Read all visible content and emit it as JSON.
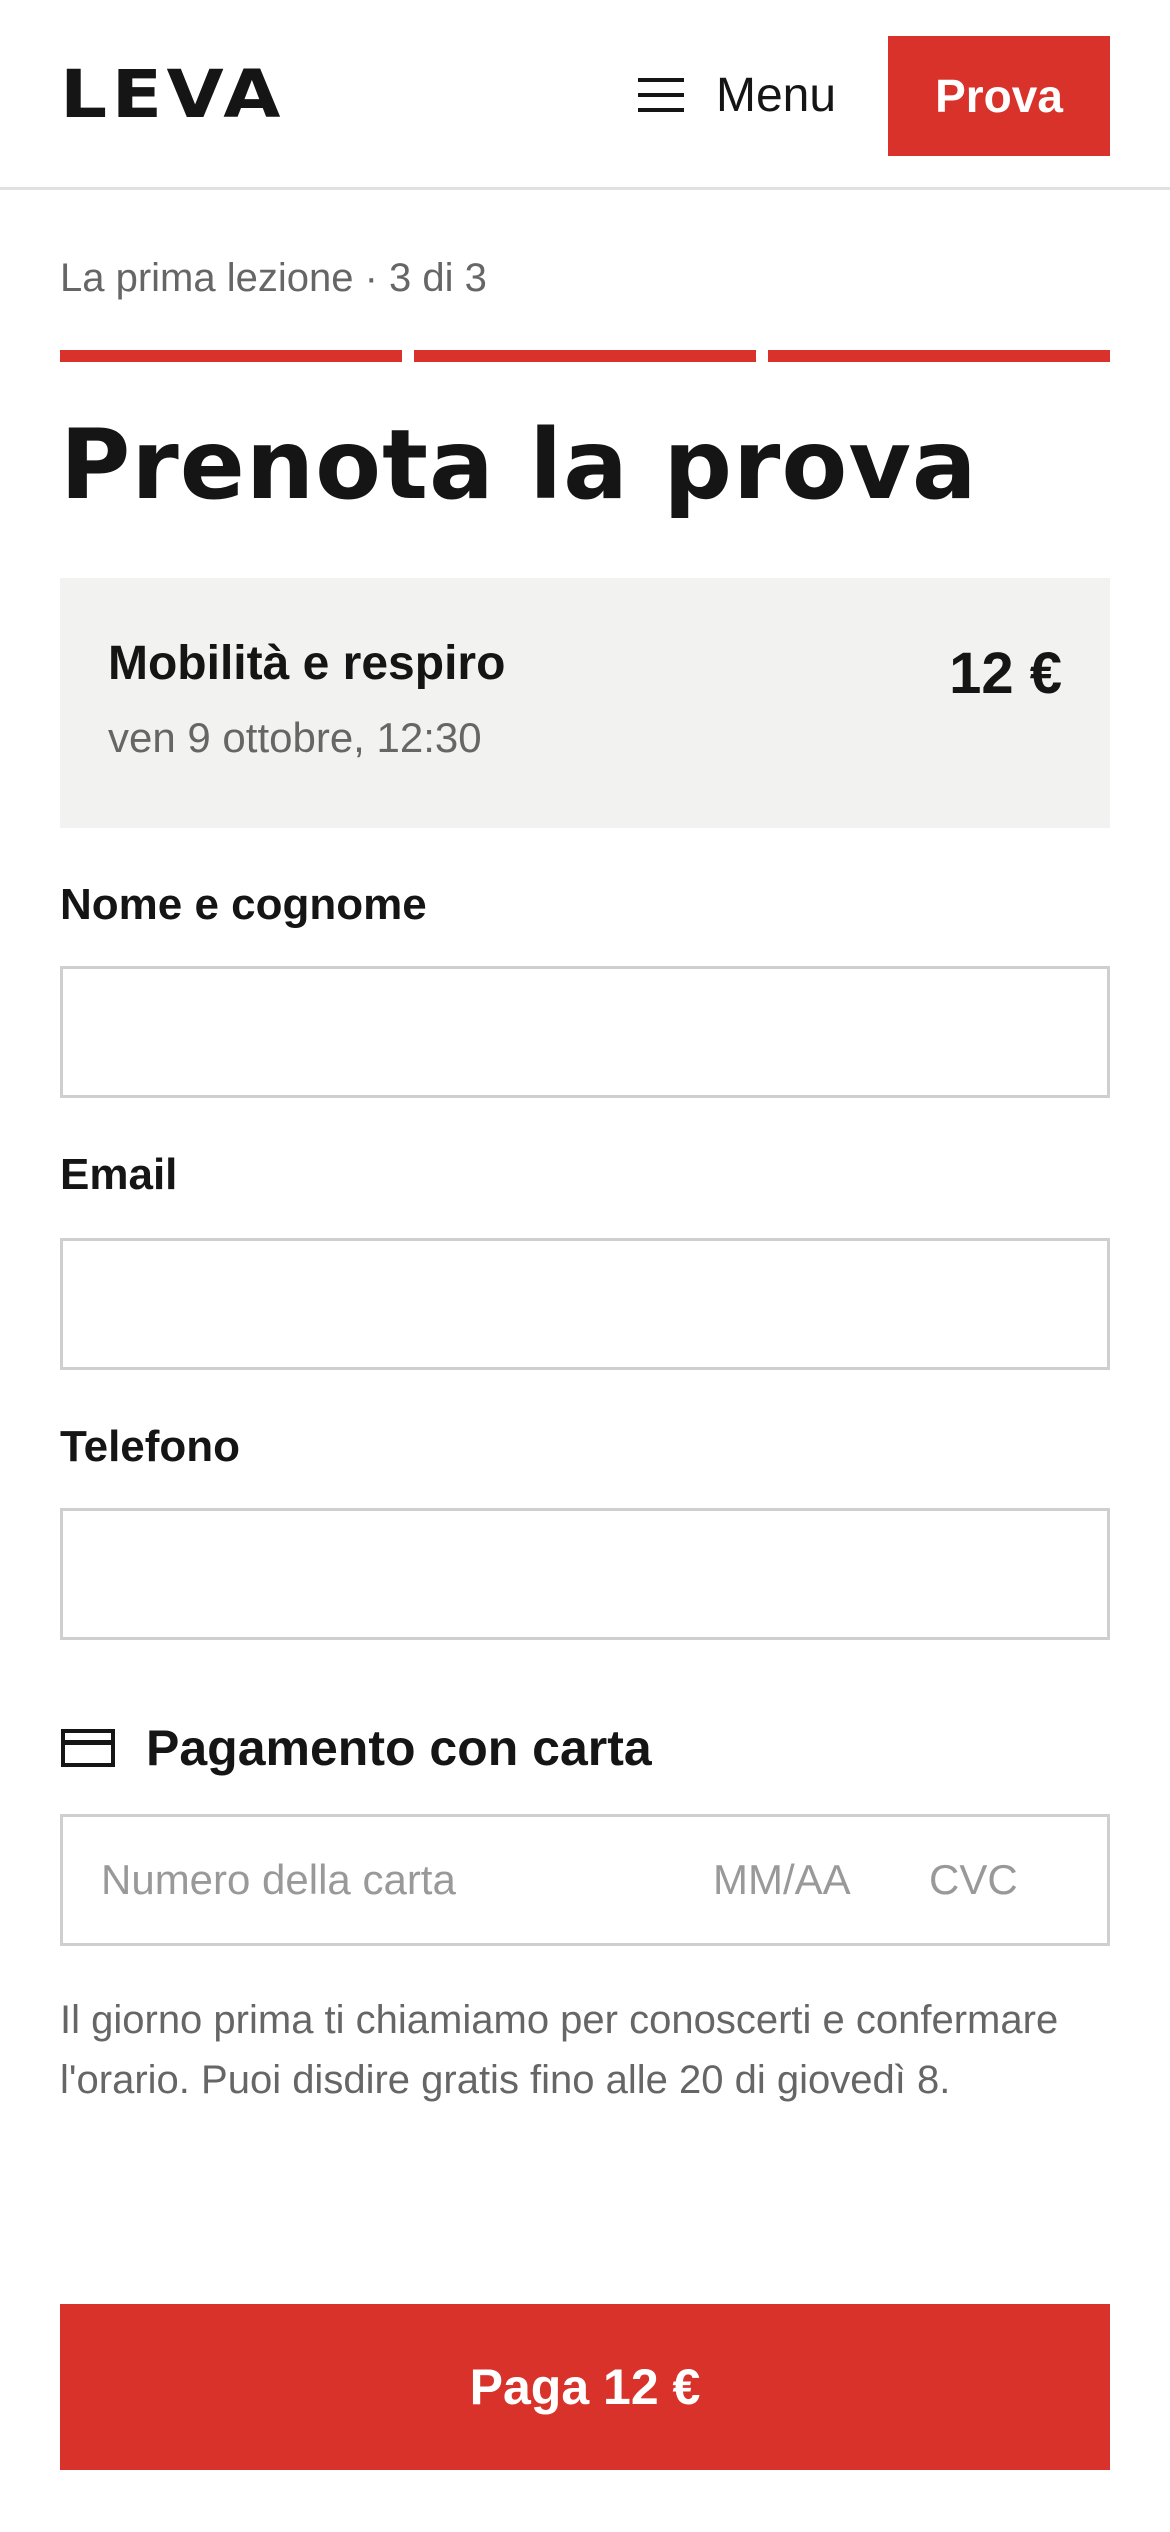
{
  "header": {
    "logo": "LEVA",
    "menu_label": "Menu",
    "menu_icon": "hamburger-icon",
    "cta_label": "Prova"
  },
  "progress": {
    "step_label": "La prima lezione · 3 di 3",
    "current_step": 3,
    "total_steps": 3,
    "color": "#d9322b"
  },
  "page": {
    "title": "Prenota la prova"
  },
  "summary": {
    "class_name": "Mobilità e respiro",
    "datetime": "ven 9 ottobre, 12:30",
    "price": "12 €"
  },
  "form": {
    "name_label": "Nome e cognome",
    "name_value": "",
    "email_label": "Email",
    "email_value": "",
    "phone_label": "Telefono",
    "phone_value": ""
  },
  "payment": {
    "icon": "credit-card-icon",
    "title": "Pagamento con carta",
    "card_number_placeholder": "Numero della carta",
    "expiry_placeholder": "MM/AA",
    "cvc_placeholder": "CVC"
  },
  "note": "Il giorno prima ti chiamiamo per conoscerti e confermare l'orario. Puoi disdire gratis fino alle 20 di giovedì 8.",
  "submit": {
    "label": "Paga 12 €"
  },
  "colors": {
    "accent": "#d9322b",
    "text": "#151515",
    "muted": "#666666",
    "summary_bg": "#f2f2f0",
    "border": "#cfcfcf"
  }
}
